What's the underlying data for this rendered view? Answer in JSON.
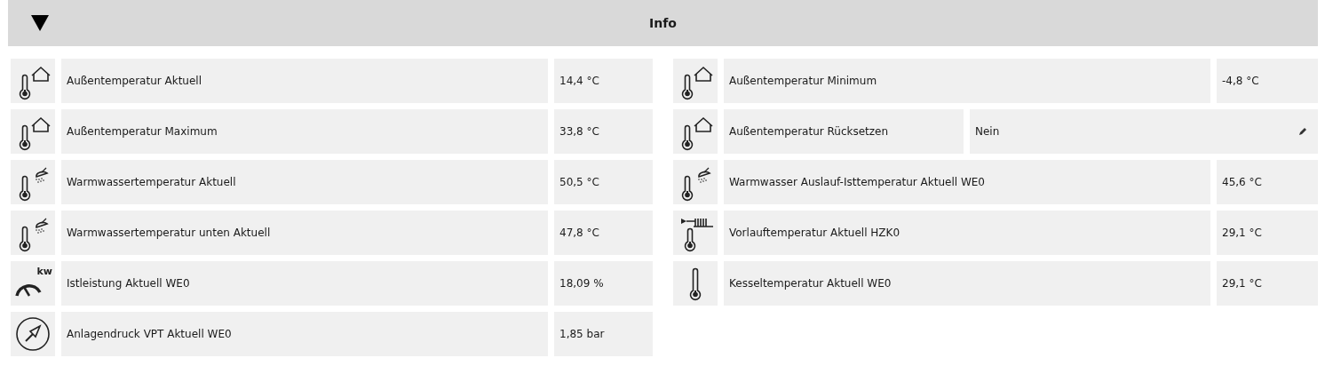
{
  "header": {
    "title": "Info",
    "expanded": true
  },
  "items": [
    {
      "kind": "outdoor",
      "editable": false,
      "label": "Außentemperatur Aktuell",
      "value": "14,4 °C"
    },
    {
      "kind": "outdoor",
      "editable": false,
      "label": "Außentemperatur Minimum",
      "value": "-4,8 °C"
    },
    {
      "kind": "outdoor",
      "editable": false,
      "label": "Außentemperatur Maximum",
      "value": "33,8 °C"
    },
    {
      "kind": "outdoor",
      "editable": true,
      "label": "Außentemperatur Rücksetzen",
      "value": "Nein"
    },
    {
      "kind": "hotwater",
      "editable": false,
      "label": "Warmwassertemperatur Aktuell",
      "value": "50,5 °C"
    },
    {
      "kind": "hotwater",
      "editable": false,
      "label": "Warmwasser Auslauf-Isttemperatur Aktuell WE0",
      "value": "45,6 °C"
    },
    {
      "kind": "hotwater",
      "editable": false,
      "label": "Warmwassertemperatur unten Aktuell",
      "value": "47,8 °C"
    },
    {
      "kind": "flow",
      "editable": false,
      "label": "Vorlauftemperatur Aktuell HZK0",
      "value": "29,1 °C"
    },
    {
      "kind": "power",
      "editable": false,
      "icon_text": "kw",
      "label": "Istleistung Aktuell WE0",
      "value": "18,09 %"
    },
    {
      "kind": "thermometer",
      "editable": false,
      "label": "Kesseltemperatur Aktuell WE0",
      "value": "29,1 °C"
    },
    {
      "kind": "pressure",
      "editable": false,
      "label": "Anlagendruck VPT Aktuell WE0",
      "value": "1,85 bar"
    }
  ]
}
